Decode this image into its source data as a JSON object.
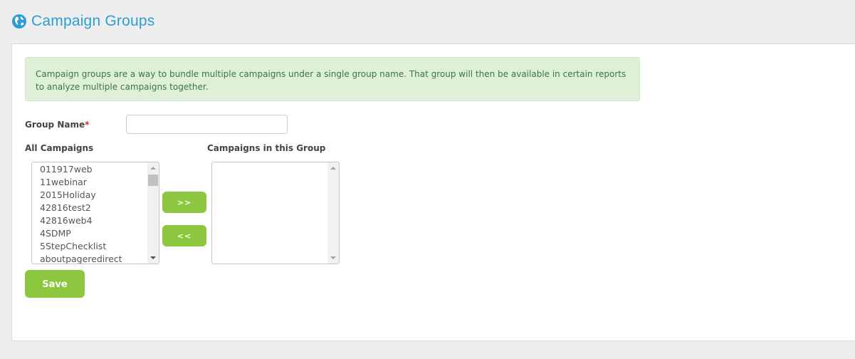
{
  "header": {
    "icon": "globe-icon",
    "title": "Campaign Groups"
  },
  "info": {
    "message": "Campaign groups are a way to bundle multiple campaigns under a single group name. That group will then be available in certain reports to analyze multiple campaigns together."
  },
  "form": {
    "group_name_label": "Group Name",
    "required_marker": "*",
    "group_name_value": "",
    "group_name_placeholder": "",
    "all_campaigns_label": "All Campaigns",
    "group_campaigns_label": "Campaigns in this Group",
    "all_campaigns": [
      "011917web",
      "11webinar",
      "2015Holiday",
      "42816test2",
      "42816web4",
      "4SDMP",
      "5StepChecklist",
      "aboutpageredirect"
    ],
    "group_campaigns": [],
    "add_label": ">>",
    "remove_label": "<<",
    "save_label": "Save"
  },
  "colors": {
    "title": "#2b9ed6",
    "button": "#8dc63f",
    "alert_bg": "#dff0d8",
    "alert_text": "#3c763d",
    "required": "#e02020"
  }
}
